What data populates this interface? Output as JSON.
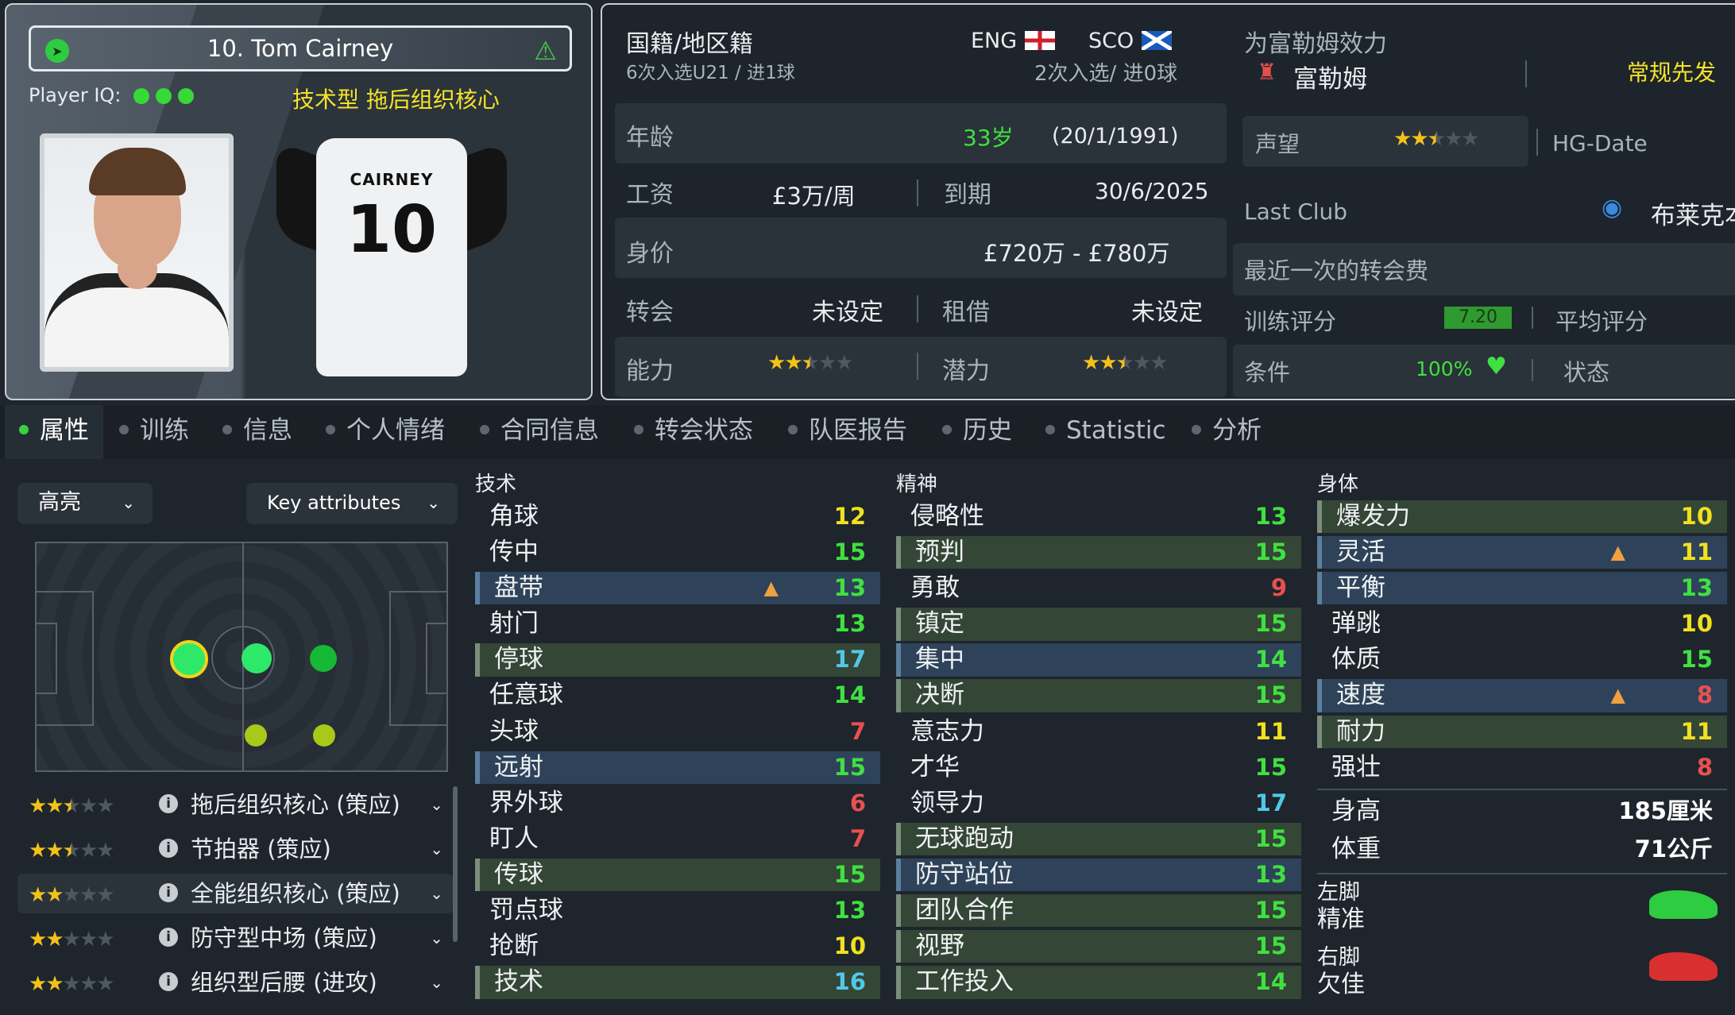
{
  "card": {
    "player_name": "10. Tom Cairney",
    "iq_label": "Player IQ:",
    "role_headline": "技术型 拖后组织核心",
    "shirt_name": "CAIRNEY",
    "shirt_number": "10"
  },
  "info": {
    "nationality_label": "国籍/地区籍",
    "u21_caps": "6次入选U21 / 进1球",
    "nation1": "ENG",
    "nation2": "SCO",
    "caps2": "2次入选/ 进0球",
    "plays_for_label": "为富勒姆效力",
    "club": "富勒姆",
    "squad_status": "常规先发",
    "age_label": "年龄",
    "age": "33岁",
    "dob": "(20/1/1991)",
    "wage_label": "工资",
    "wage": "£3万/周",
    "expiry_label": "到期",
    "expiry": "30/6/2025",
    "value_label": "身价",
    "value": "£720万 - £780万",
    "transfer_label": "转会",
    "transfer": "未设定",
    "loan_label": "租借",
    "loan": "未设定",
    "ability_label": "能力",
    "ability_stars": 2.5,
    "potential_label": "潜力",
    "potential_stars": 2.5,
    "reputation_label": "声望",
    "reputation_stars": 2.5,
    "hg_label": "HG-Date",
    "last_club_label": "Last Club",
    "last_club": "布莱克本",
    "last_fee_label": "最近一次的转会费",
    "training_label": "训练评分",
    "training_rating": "7.20",
    "avg_label": "平均评分",
    "condition_label": "条件",
    "condition": "100%",
    "status_label": "状态"
  },
  "tabs": [
    "属性",
    "训练",
    "信息",
    "个人情绪",
    "合同信息",
    "转会状态",
    "队医报告",
    "历史",
    "Statistic",
    "分析"
  ],
  "filters": {
    "highlight": "高亮",
    "key": "Key attributes"
  },
  "roles": [
    {
      "name": "拖后组织核心 (策应)",
      "stars": 2.5
    },
    {
      "name": "节拍器 (策应)",
      "stars": 2.5
    },
    {
      "name": "全能组织核心 (策应)",
      "stars": 2
    },
    {
      "name": "防守型中场 (策应)",
      "stars": 2
    },
    {
      "name": "组织型后腰 (进攻)",
      "stars": 2
    }
  ],
  "technical": {
    "title": "技术",
    "attrs": [
      {
        "n": "角球",
        "v": "12",
        "c": "#f0e020",
        "h": ""
      },
      {
        "n": "传中",
        "v": "15",
        "c": "#40e040",
        "h": ""
      },
      {
        "n": "盘带",
        "v": "13",
        "c": "#40e040",
        "h": "h2",
        "up": true
      },
      {
        "n": "射门",
        "v": "13",
        "c": "#40e040",
        "h": ""
      },
      {
        "n": "停球",
        "v": "17",
        "c": "#50c8e8",
        "h": "h1"
      },
      {
        "n": "任意球",
        "v": "14",
        "c": "#40e040",
        "h": ""
      },
      {
        "n": "头球",
        "v": "7",
        "c": "#e85050",
        "h": ""
      },
      {
        "n": "远射",
        "v": "15",
        "c": "#40e040",
        "h": "h2"
      },
      {
        "n": "界外球",
        "v": "6",
        "c": "#e85050",
        "h": ""
      },
      {
        "n": "盯人",
        "v": "7",
        "c": "#e85050",
        "h": ""
      },
      {
        "n": "传球",
        "v": "15",
        "c": "#40e040",
        "h": "h1"
      },
      {
        "n": "罚点球",
        "v": "13",
        "c": "#40e040",
        "h": ""
      },
      {
        "n": "抢断",
        "v": "10",
        "c": "#f0e020",
        "h": ""
      },
      {
        "n": "技术",
        "v": "16",
        "c": "#50c8e8",
        "h": "h1"
      }
    ]
  },
  "mental": {
    "title": "精神",
    "attrs": [
      {
        "n": "侵略性",
        "v": "13",
        "c": "#40e040",
        "h": ""
      },
      {
        "n": "预判",
        "v": "15",
        "c": "#40e040",
        "h": "h1"
      },
      {
        "n": "勇敢",
        "v": "9",
        "c": "#e85050",
        "h": ""
      },
      {
        "n": "镇定",
        "v": "15",
        "c": "#40e040",
        "h": "h1"
      },
      {
        "n": "集中",
        "v": "14",
        "c": "#40e040",
        "h": "h2"
      },
      {
        "n": "决断",
        "v": "15",
        "c": "#40e040",
        "h": "h1"
      },
      {
        "n": "意志力",
        "v": "11",
        "c": "#f0e020",
        "h": ""
      },
      {
        "n": "才华",
        "v": "15",
        "c": "#40e040",
        "h": ""
      },
      {
        "n": "领导力",
        "v": "17",
        "c": "#50c8e8",
        "h": ""
      },
      {
        "n": "无球跑动",
        "v": "15",
        "c": "#40e040",
        "h": "h1"
      },
      {
        "n": "防守站位",
        "v": "13",
        "c": "#40e040",
        "h": "h2"
      },
      {
        "n": "团队合作",
        "v": "15",
        "c": "#40e040",
        "h": "h1"
      },
      {
        "n": "视野",
        "v": "15",
        "c": "#40e040",
        "h": "h1"
      },
      {
        "n": "工作投入",
        "v": "14",
        "c": "#40e040",
        "h": "h1"
      }
    ]
  },
  "physical": {
    "title": "身体",
    "attrs": [
      {
        "n": "爆发力",
        "v": "10",
        "c": "#f0e020",
        "h": "h1"
      },
      {
        "n": "灵活",
        "v": "11",
        "c": "#f0e020",
        "h": "h2",
        "up": true
      },
      {
        "n": "平衡",
        "v": "13",
        "c": "#40e040",
        "h": "h2"
      },
      {
        "n": "弹跳",
        "v": "10",
        "c": "#f0e020",
        "h": ""
      },
      {
        "n": "体质",
        "v": "15",
        "c": "#40e040",
        "h": ""
      },
      {
        "n": "速度",
        "v": "8",
        "c": "#e85050",
        "h": "h2",
        "up": true
      },
      {
        "n": "耐力",
        "v": "11",
        "c": "#f0e020",
        "h": "h1"
      },
      {
        "n": "强壮",
        "v": "8",
        "c": "#e85050",
        "h": ""
      }
    ],
    "height_label": "身高",
    "height": "185厘米",
    "weight_label": "体重",
    "weight": "71公斤",
    "left_foot_label": "左脚",
    "left_foot": "精准",
    "right_foot_label": "右脚",
    "right_foot": "欠佳"
  },
  "colors": {
    "green": "#40e040",
    "yellow": "#f0e020",
    "red": "#e85050",
    "blue": "#50c8e8",
    "star": "#f2c21a"
  }
}
